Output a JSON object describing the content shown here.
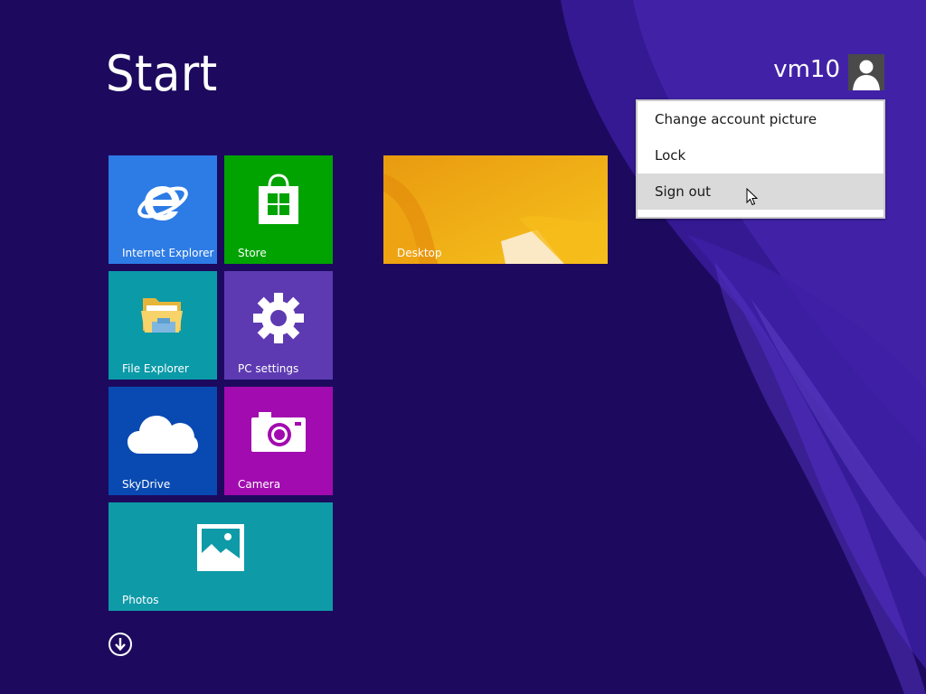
{
  "header": {
    "title": "Start"
  },
  "user": {
    "name": "vm10"
  },
  "account_menu": {
    "items": [
      {
        "label": "Change account picture"
      },
      {
        "label": "Lock"
      },
      {
        "label": "Sign out"
      }
    ]
  },
  "tiles": {
    "internet_explorer": {
      "label": "Internet Explorer",
      "color": "#2d7be5",
      "icon": "internet-explorer-icon"
    },
    "store": {
      "label": "Store",
      "color": "#00a300",
      "icon": "store-bag-icon"
    },
    "desktop": {
      "label": "Desktop",
      "color": "#f4b417",
      "icon": "desktop-wallpaper"
    },
    "file_explorer": {
      "label": "File Explorer",
      "color": "#0b9aa8",
      "icon": "folder-icon"
    },
    "pc_settings": {
      "label": "PC settings",
      "color": "#5d3ab2",
      "icon": "gear-icon"
    },
    "skydrive": {
      "label": "SkyDrive",
      "color": "#094ab2",
      "icon": "cloud-icon"
    },
    "camera": {
      "label": "Camera",
      "color": "#a20baf",
      "icon": "camera-icon"
    },
    "photos": {
      "label": "Photos",
      "color": "#0f9aa8",
      "icon": "photo-icon"
    }
  },
  "colors": {
    "background": "#1d0a5e",
    "menu_hover": "#dadada"
  }
}
